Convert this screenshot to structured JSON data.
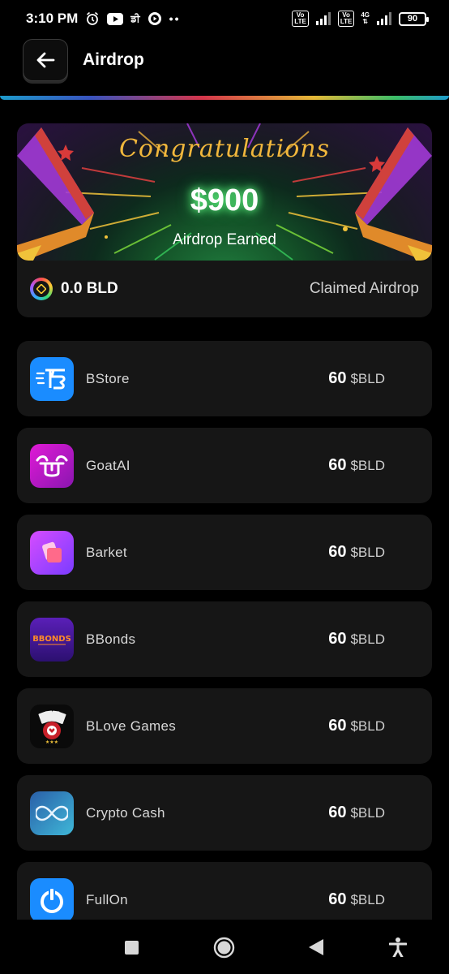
{
  "status_bar": {
    "time": "3:10 PM",
    "extra_text": "ਡੀ",
    "dots": "••",
    "net_4g": "4G",
    "volte_label": "Vo LTE",
    "battery": "90"
  },
  "header": {
    "title": "Airdrop"
  },
  "banner": {
    "congrats_text": "Congratulations",
    "amount": "$900",
    "subtitle": "Airdrop Earned"
  },
  "balance": {
    "amount": "0.0 BLD",
    "status": "Claimed Airdrop"
  },
  "apps": [
    {
      "name": "BStore",
      "reward": "60",
      "unit": "$BLD",
      "icon": "bstore-icon",
      "color": "#1a8cff"
    },
    {
      "name": "GoatAI",
      "reward": "60",
      "unit": "$BLD",
      "icon": "goatai-icon",
      "color": "#c21ad6"
    },
    {
      "name": "Barket",
      "reward": "60",
      "unit": "$BLD",
      "icon": "barket-icon",
      "color": "#b44cff"
    },
    {
      "name": "BBonds",
      "reward": "60",
      "unit": "$BLD",
      "icon": "bbonds-icon",
      "color": "#4a1fa8"
    },
    {
      "name": "BLove Games",
      "reward": "60",
      "unit": "$BLD",
      "icon": "blove-games-icon",
      "color": "#111111"
    },
    {
      "name": "Crypto Cash",
      "reward": "60",
      "unit": "$BLD",
      "icon": "crypto-cash-icon",
      "color": "#1e6fa8"
    },
    {
      "name": "FullOn",
      "reward": "60",
      "unit": "$BLD",
      "icon": "fullon-icon",
      "color": "#1a8cff"
    }
  ],
  "colors": {
    "background": "#000000",
    "card": "#161616",
    "accent_gold": "#f1b73c",
    "glow_green": "#2fd55a"
  }
}
